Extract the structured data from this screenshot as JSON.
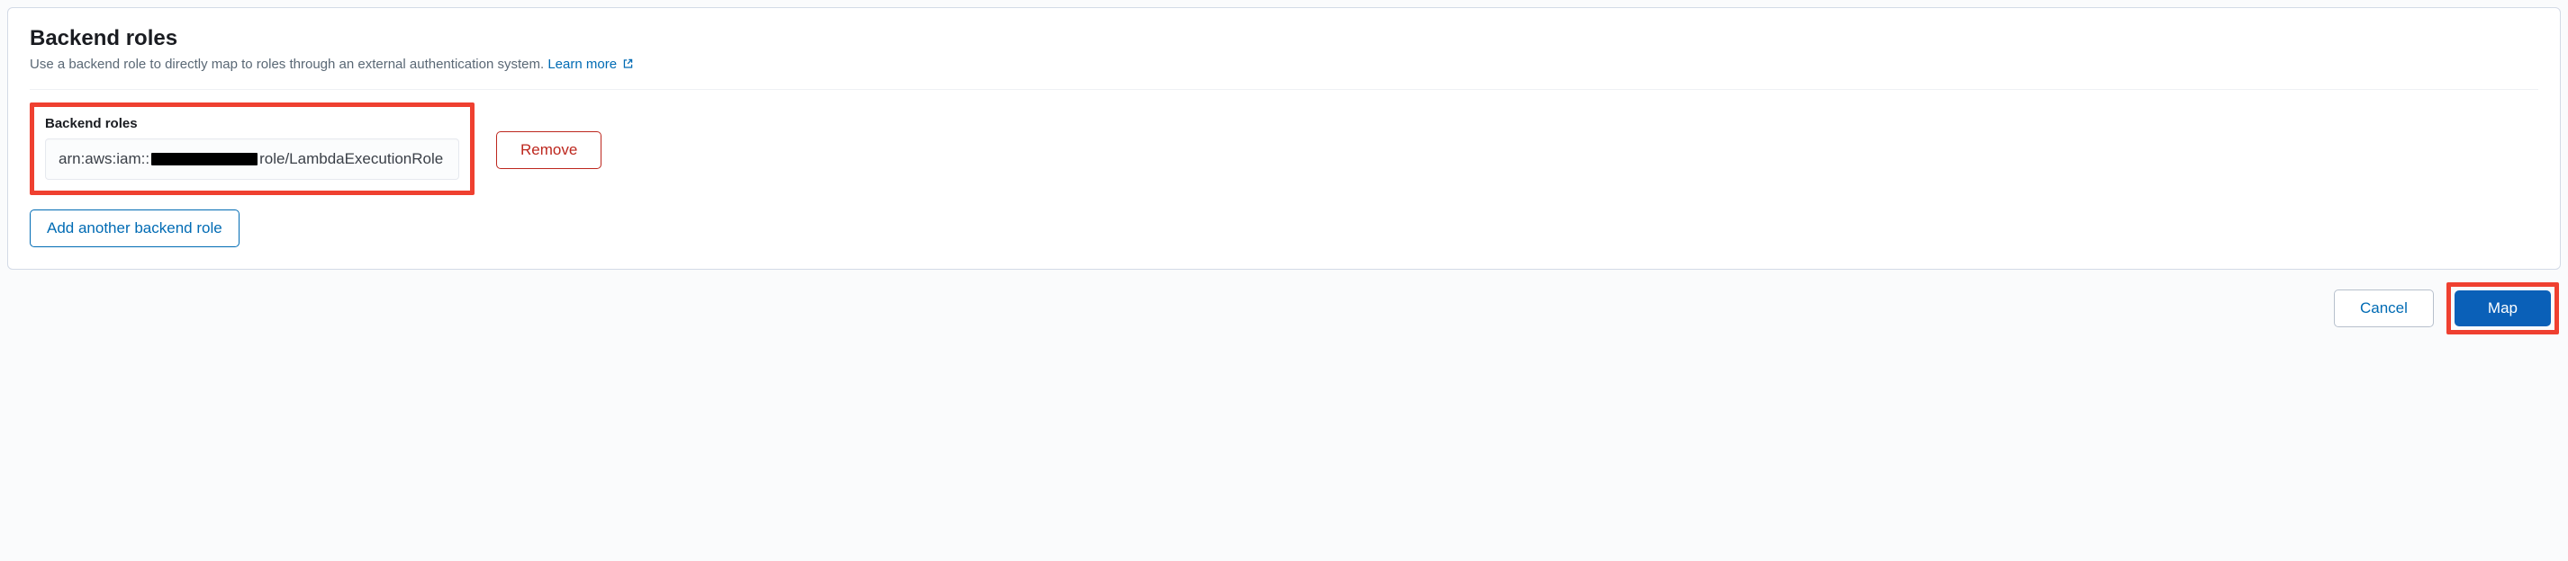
{
  "panel": {
    "title": "Backend roles",
    "description": "Use a backend role to directly map to roles through an external authentication system.",
    "learnMore": "Learn more"
  },
  "form": {
    "fieldLabel": "Backend roles",
    "roleValuePrefix": "arn:aws:iam::",
    "roleValueSuffix": "role/LambdaExecutionRole",
    "remove": "Remove",
    "addAnother": "Add another backend role"
  },
  "footer": {
    "cancel": "Cancel",
    "map": "Map"
  }
}
